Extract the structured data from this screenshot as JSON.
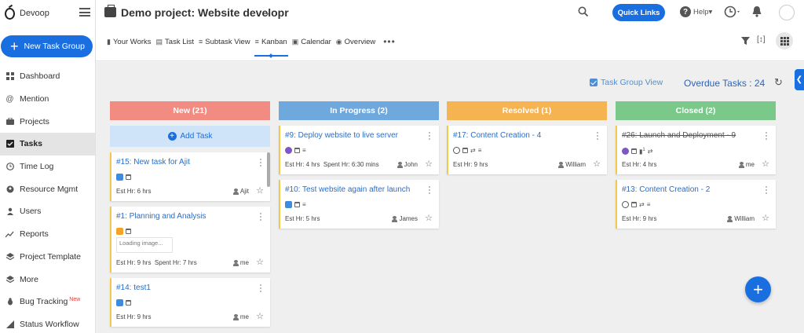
{
  "app": {
    "brand": "Devoop"
  },
  "sidebar": {
    "new_group_label": "New Task Group",
    "items": [
      {
        "label": "Dashboard",
        "icon": "dashboard-icon"
      },
      {
        "label": "Mention",
        "icon": "at-icon"
      },
      {
        "label": "Projects",
        "icon": "briefcase-icon"
      },
      {
        "label": "Tasks",
        "icon": "checkbox-icon",
        "active": true
      },
      {
        "label": "Time Log",
        "icon": "clock-icon"
      },
      {
        "label": "Resource Mgmt",
        "icon": "resource-icon"
      },
      {
        "label": "Users",
        "icon": "user-icon"
      },
      {
        "label": "Reports",
        "icon": "trend-icon"
      },
      {
        "label": "Project Template",
        "icon": "layers-icon"
      },
      {
        "label": "More",
        "icon": "layers-icon"
      },
      {
        "label": "Bug Tracking",
        "icon": "bug-icon",
        "badge": "New"
      },
      {
        "label": "Status Workflow",
        "icon": "workflow-icon"
      }
    ]
  },
  "header": {
    "project_title": "Demo project: Website developr",
    "quick_links": "Quick Links",
    "help": "Help"
  },
  "views": {
    "tabs": [
      {
        "label": "Your Works",
        "icon": "doc-icon"
      },
      {
        "label": "Task List",
        "icon": "list-icon"
      },
      {
        "label": "Subtask View",
        "icon": "subtask-icon"
      },
      {
        "label": "Kanban",
        "icon": "kanban-icon",
        "active": true
      },
      {
        "label": "Calendar",
        "icon": "calendar-icon"
      },
      {
        "label": "Overview",
        "icon": "eye-icon"
      }
    ],
    "more": "•••"
  },
  "board": {
    "task_group_view": "Task Group View",
    "overdue": "Overdue Tasks : 24",
    "add_task": "Add Task",
    "loading_image": "Loading image...",
    "columns": [
      {
        "title": "New (21)",
        "color": "#f28b82",
        "cards": [
          {
            "title": "#15: New task for Ajit",
            "est": "Est Hr: 6 hrs",
            "assignee": "Ajit"
          },
          {
            "title": "#1: Planning and Analysis",
            "est": "Est Hr: 9 hrs",
            "spent": "Spent Hr: 7 hrs",
            "assignee": "me"
          },
          {
            "title": "#14: test1",
            "est": "Est Hr: 9 hrs",
            "assignee": "me"
          }
        ]
      },
      {
        "title": "In Progress (2)",
        "color": "#6fa8dc",
        "cards": [
          {
            "title": "#9: Deploy website to live server",
            "est": "Est Hr: 4 hrs",
            "spent": "Spent Hr: 6:30 mins",
            "assignee": "John"
          },
          {
            "title": "#10: Test website again after launch",
            "est": "Est Hr: 5 hrs",
            "assignee": "James"
          }
        ]
      },
      {
        "title": "Resolved (1)",
        "color": "#f6b352",
        "cards": [
          {
            "title": "#17: Content Creation - 4",
            "est": "Est Hr: 9 hrs",
            "assignee": "William"
          }
        ]
      },
      {
        "title": "Closed (2)",
        "color": "#7bc98a",
        "cards": [
          {
            "title": "#26: Launch and Deployment - 9",
            "est": "Est Hr: 4 hrs",
            "assignee": "me",
            "comments": "1"
          },
          {
            "title": "#13: Content Creation - 2",
            "est": "Est Hr: 9 hrs",
            "assignee": "William"
          }
        ]
      }
    ]
  }
}
